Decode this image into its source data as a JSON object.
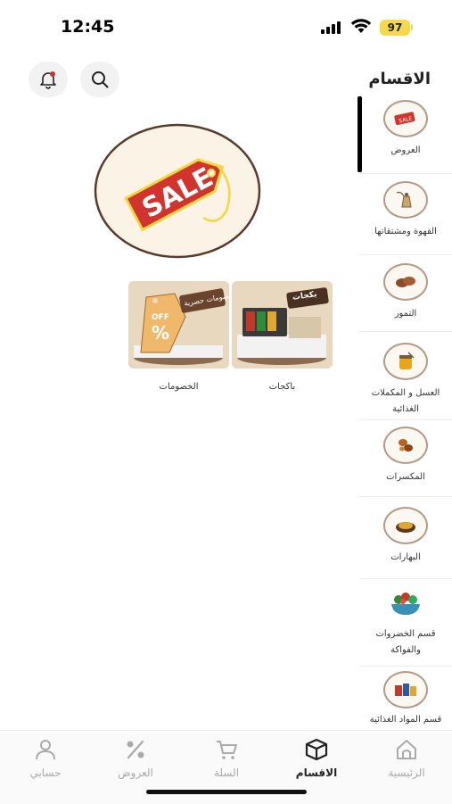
{
  "status_bar": {
    "time": "12:45",
    "battery": "97"
  },
  "sidebar": {
    "title": "الاقسام",
    "items": [
      {
        "label": "العروض",
        "icon": "sale-tag-icon"
      },
      {
        "label": "القهوة ومشتقاتها",
        "icon": "coffee-pot-icon"
      },
      {
        "label": "التمور",
        "icon": "dates-icon"
      },
      {
        "label": "العسل و المكملات الغذائية",
        "icon": "honey-icon"
      },
      {
        "label": "المكسرات",
        "icon": "nuts-icon"
      },
      {
        "label": "البهارات",
        "icon": "spices-icon"
      },
      {
        "label": "قسم الخضروات والفواكة",
        "icon": "vegetables-icon"
      },
      {
        "label": "قسم المواد الغذائية",
        "icon": "groceries-icon"
      }
    ]
  },
  "hero": {
    "text": "SALE"
  },
  "subcategories": [
    {
      "label": "باكجات",
      "badge_text": "بكجات"
    },
    {
      "label": "الخصومات",
      "badge_text": "خصومات حصرية",
      "discount_text": "OFF",
      "percent": "%"
    }
  ],
  "bottom_nav": [
    {
      "label": "الرئيسية",
      "icon": "home-icon"
    },
    {
      "label": "الاقسام",
      "icon": "box-icon",
      "active": true
    },
    {
      "label": "السلة",
      "icon": "cart-icon"
    },
    {
      "label": "العروض",
      "icon": "percent-icon"
    },
    {
      "label": "حسابي",
      "icon": "user-icon"
    }
  ],
  "colors": {
    "accent": "#222222",
    "sale_red": "#d0342c",
    "sale_yellow": "#f3d640",
    "card_bg": "#e9d8c0",
    "inactive": "#aaaaaa"
  }
}
